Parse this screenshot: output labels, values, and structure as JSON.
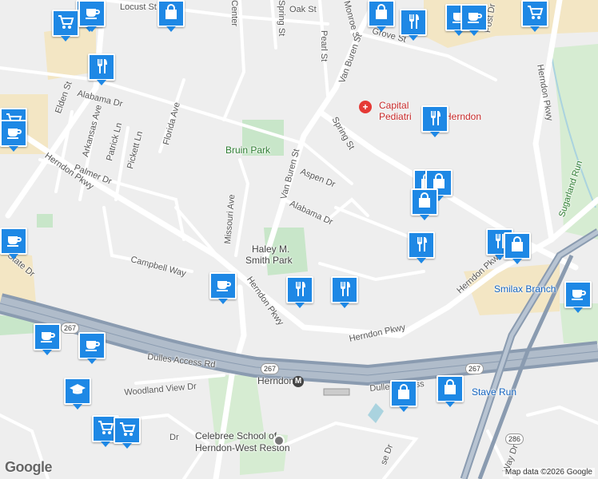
{
  "map": {
    "attribution": "Map data ©2026 Google",
    "logo": "Google",
    "metro_symbol": "M"
  },
  "streets": {
    "locust": "Locust St",
    "oak": "Oak St",
    "center": "Center",
    "spring_top": "Spring St",
    "pearl": "Pearl St",
    "monroe": "Monroe St",
    "grove": "Grove St",
    "post": "Post Dr",
    "van_buren_n": "Van Buren St",
    "van_buren_s": "Van Buren St",
    "elden": "Elden St",
    "alabama_w": "Alabama Dr",
    "alabama_e": "Alabama Dr",
    "arkansas": "Arkansas Ave",
    "patrick": "Patrick Ln",
    "pickett": "Pickett Ln",
    "florida": "Florida Ave",
    "palmer": "Palmer Dr",
    "herndon_pkwy_w": "Herndon Pkwy",
    "herndon_pkwy_mid": "Herndon Pkwy",
    "herndon_pkwy_s": "Herndon Pkwy",
    "herndon_pkwy_e": "Herndon Pkwy",
    "herndon_pkwy_ne": "Herndon Pkwy",
    "spring_mid": "Spring St",
    "aspen": "Aspen Dr",
    "missouri": "Missouri Ave",
    "campbell": "Campbell Way",
    "state": "State Dr",
    "dulles_w": "Dulles Access Rd",
    "dulles_e": "Dulles Access",
    "woodland": "Woodland View Dr",
    "sugarland": "Sugarland Run",
    "herndon_station": "Herndon",
    "dr_sw": "Dr",
    "se_partial": "se Dr",
    "way_dr": "Way Dr"
  },
  "places": {
    "bruin_park": "Bruin Park",
    "haley_smith_park_1": "Haley M.",
    "haley_smith_park_2": "Smith Park",
    "capital_1": "Capital",
    "capital_2": "Pediatri",
    "capital_herndon": "Herndon",
    "smilax": "Smilax Branch",
    "stave_run": "Stave Run",
    "celebree_1": "Celebree School of",
    "celebree_2": "Herndon-West Reston"
  },
  "shields": {
    "r267_a": "267",
    "r267_b": "267",
    "r267_c": "267",
    "r286": "286"
  },
  "pins": [
    {
      "icon": "cafe-icon"
    },
    {
      "icon": "shopping-bag-icon"
    },
    {
      "icon": "shopping-bag-icon"
    },
    {
      "icon": "grocery-cart-icon"
    },
    {
      "icon": "cafe-icon"
    },
    {
      "icon": "restaurant-icon"
    },
    {
      "icon": "cafe-icon"
    },
    {
      "icon": "cafe-icon"
    },
    {
      "icon": "grocery-cart-icon"
    },
    {
      "icon": "restaurant-icon"
    },
    {
      "icon": "grocery-cart-icon"
    },
    {
      "icon": "cafe-icon"
    },
    {
      "icon": "restaurant-icon"
    },
    {
      "icon": "shopping-bag-icon"
    },
    {
      "icon": "shopping-bag-icon"
    },
    {
      "icon": "shopping-bag-icon"
    },
    {
      "icon": "cafe-icon"
    },
    {
      "icon": "restaurant-icon"
    },
    {
      "icon": "restaurant-icon"
    },
    {
      "icon": "shopping-bag-icon"
    },
    {
      "icon": "cafe-icon"
    },
    {
      "icon": "restaurant-icon"
    },
    {
      "icon": "restaurant-icon"
    },
    {
      "icon": "cafe-icon"
    },
    {
      "icon": "cafe-icon"
    },
    {
      "icon": "cafe-icon"
    },
    {
      "icon": "school-icon"
    },
    {
      "icon": "shopping-bag-icon"
    },
    {
      "icon": "shopping-bag-icon"
    },
    {
      "icon": "grocery-cart-icon"
    },
    {
      "icon": "grocery-cart-icon"
    }
  ],
  "colors": {
    "pin": "#1e88e5",
    "park": "#c8e6c9",
    "commercial": "#f3e6c4",
    "highway": "#8a9bb0",
    "water": "#aad3df"
  }
}
